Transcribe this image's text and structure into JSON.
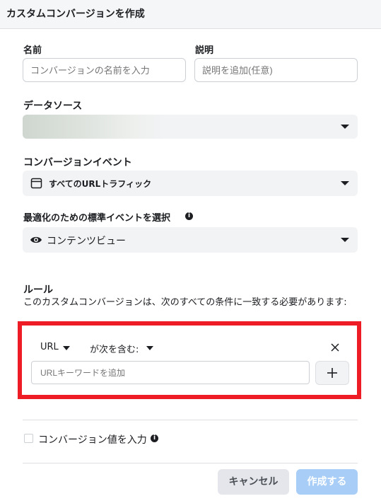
{
  "header": {
    "title": "カスタムコンバージョンを作成"
  },
  "name_field": {
    "label": "名前",
    "placeholder": "コンバージョンの名前を入力"
  },
  "description_field": {
    "label": "説明",
    "placeholder": "説明を追加(任意)"
  },
  "data_source": {
    "label": "データソース"
  },
  "conversion_event": {
    "label": "コンバージョンイベント",
    "value": "すべてのURLトラフィック",
    "icon": "calendar-icon"
  },
  "optimization": {
    "label": "最適化のための標準イベントを選択",
    "value": "コンテンツビュー",
    "icon": "eye-icon"
  },
  "rules": {
    "title": "ルール",
    "description": "このカスタムコンバージョンは、次のすべての条件に一致する必要があります:",
    "field_select": "URL",
    "operator_select": "が次を含む:",
    "keyword_placeholder": "URLキーワードを追加"
  },
  "conversion_value": {
    "label": "コンバージョン値を入力"
  },
  "footer": {
    "cancel_label": "キャンセル",
    "create_label": "作成する"
  },
  "colors": {
    "highlight": "#ee1c25",
    "primary_disabled": "#a8cdf6"
  }
}
